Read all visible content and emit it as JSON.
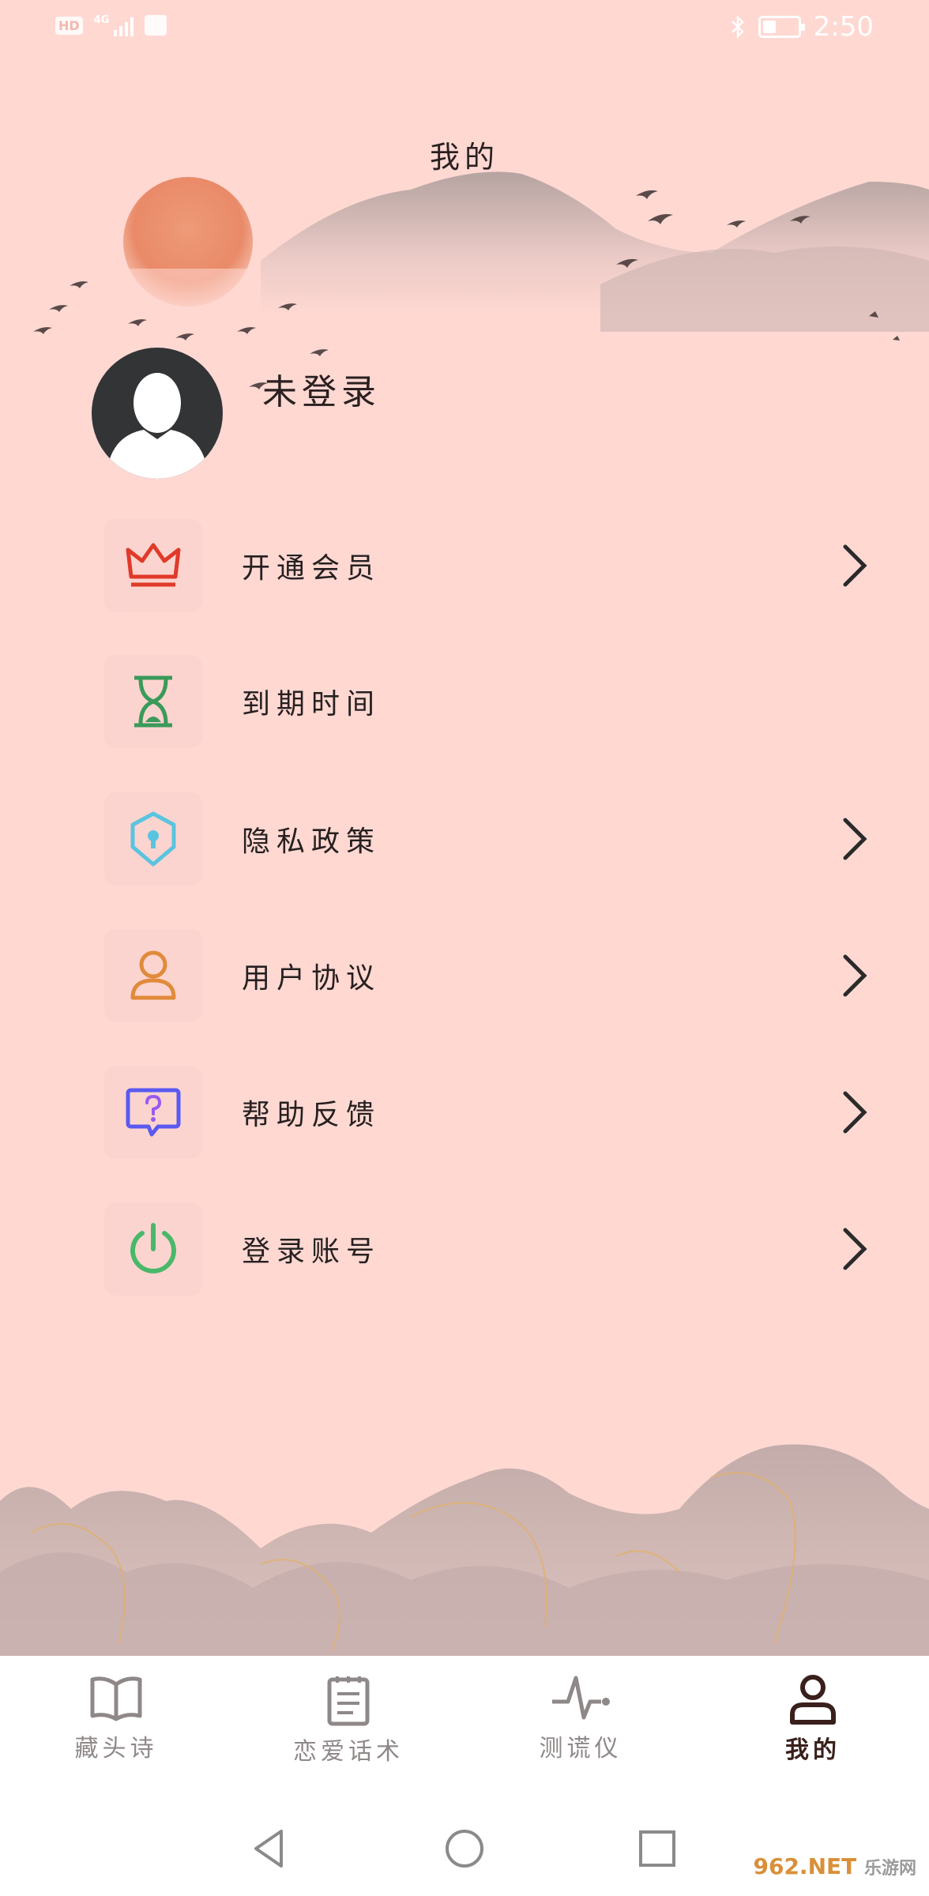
{
  "status_bar": {
    "time": "2:50",
    "left_badges": [
      "HD",
      "4G"
    ],
    "battery_level": 0.4
  },
  "header": {
    "title": "我的"
  },
  "profile": {
    "login_status": "未登录"
  },
  "menu": [
    {
      "label": "开通会员",
      "icon": "crown-icon",
      "color": "#e03a2a",
      "has_chevron": true
    },
    {
      "label": "到期时间",
      "icon": "hourglass-icon",
      "color": "#3a9a5a",
      "has_chevron": false
    },
    {
      "label": "隐私政策",
      "icon": "shield-lock-icon",
      "color": "#5ac4e0",
      "has_chevron": true
    },
    {
      "label": "用户协议",
      "icon": "user-icon",
      "color": "#e08a3a",
      "has_chevron": true
    },
    {
      "label": "帮助反馈",
      "icon": "help-bubble-icon",
      "color": "#5a5af0",
      "has_chevron": true
    },
    {
      "label": "登录账号",
      "icon": "power-icon",
      "color": "#4ab86a",
      "has_chevron": true
    }
  ],
  "tabbar": {
    "tabs": [
      {
        "label": "藏头诗",
        "icon": "book-icon",
        "active": false
      },
      {
        "label": "恋爱话术",
        "icon": "notepad-icon",
        "active": false
      },
      {
        "label": "测谎仪",
        "icon": "pulse-icon",
        "active": false
      },
      {
        "label": "我的",
        "icon": "person-icon",
        "active": true
      }
    ]
  },
  "watermark": {
    "brand": "962.NET",
    "sub": "乐游网"
  },
  "colors": {
    "background": "#ffd8d2",
    "sun": "#e98a68",
    "active_tab": "#3a201c",
    "inactive_tab": "#8f8888"
  }
}
